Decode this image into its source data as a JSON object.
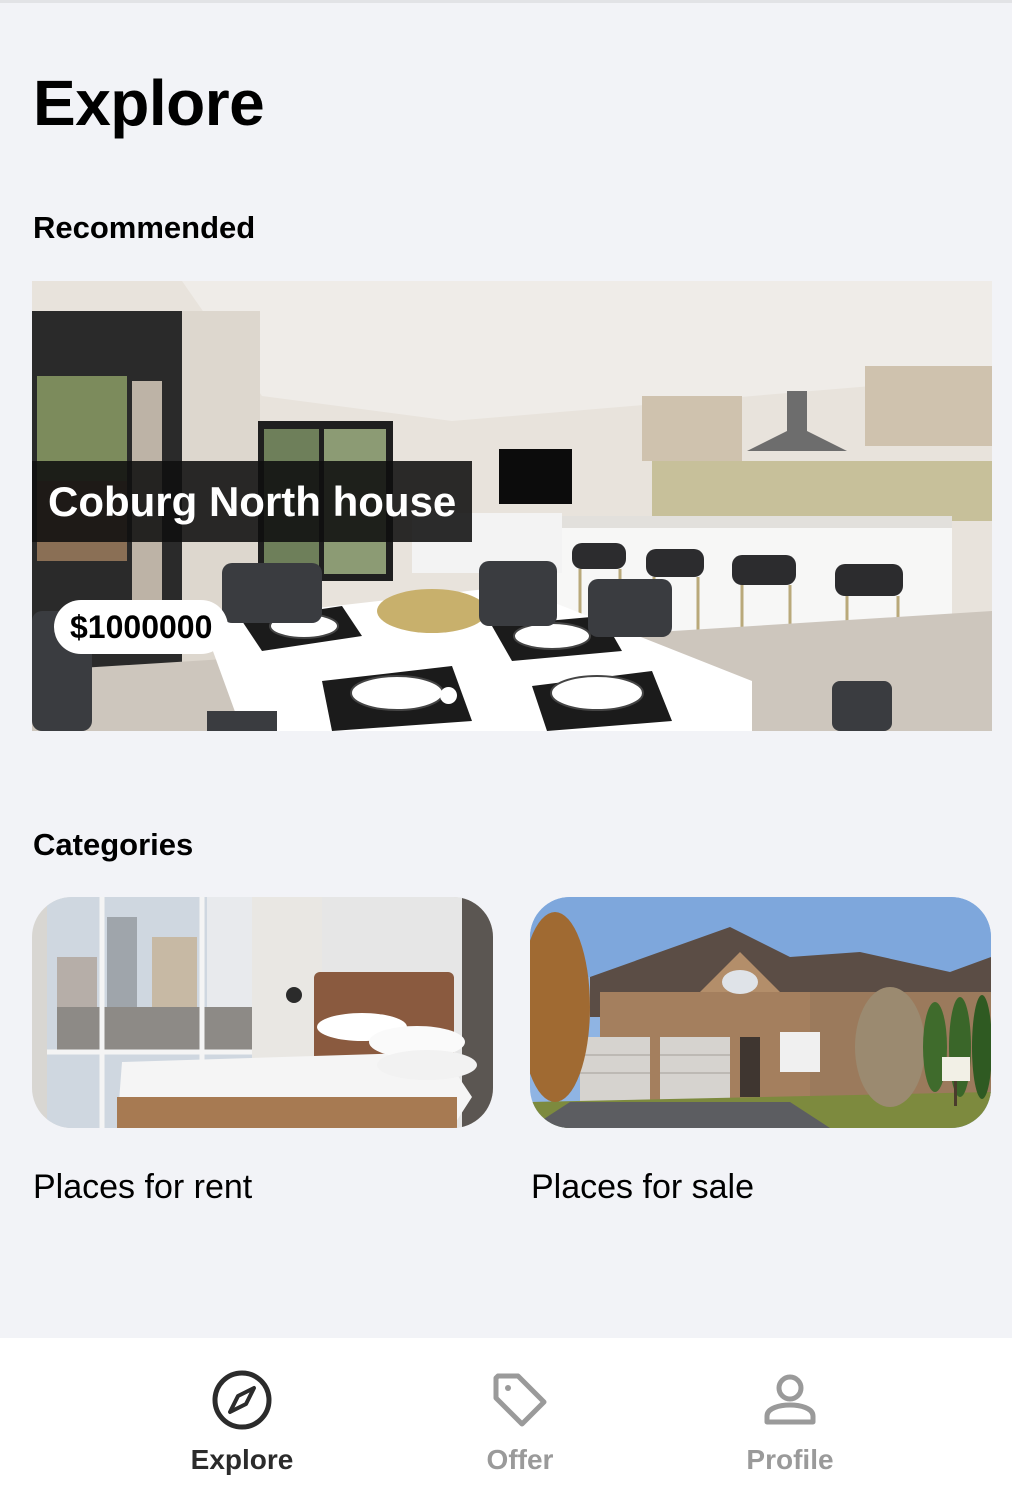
{
  "page": {
    "title": "Explore",
    "background": "#f2f3f7"
  },
  "recommended": {
    "heading": "Recommended",
    "featured": {
      "title": "Coburg North house",
      "price": "$1000000",
      "image_icon": "kitchen-dining-photo",
      "carousel_pages": 3,
      "active_page": 1
    }
  },
  "categories": {
    "heading": "Categories",
    "items": [
      {
        "label": "Places for rent",
        "image_icon": "bedroom-photo"
      },
      {
        "label": "Places for sale",
        "image_icon": "house-exterior-photo"
      }
    ]
  },
  "bottom_nav": {
    "active": "Explore",
    "active_color": "#2b2b2b",
    "inactive_color": "#9a9a9a",
    "items": [
      {
        "label": "Explore",
        "icon": "compass-icon"
      },
      {
        "label": "Offer",
        "icon": "tag-icon"
      },
      {
        "label": "Profile",
        "icon": "person-icon"
      }
    ]
  }
}
